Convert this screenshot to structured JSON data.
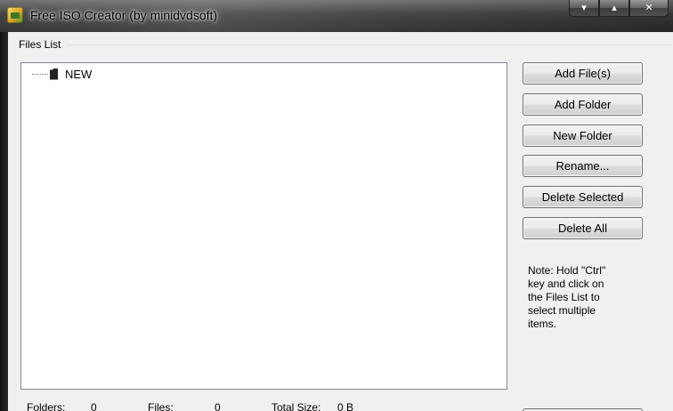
{
  "window": {
    "title": "Free ISO Creator (by minidvdsoft)",
    "caption_buttons": [
      "▾",
      "▴",
      "✕"
    ]
  },
  "files_list": {
    "label": "Files List",
    "tree_items": [
      {
        "label": "NEW"
      }
    ]
  },
  "buttons": {
    "add_files": "Add File(s)",
    "add_folder": "Add Folder",
    "new_folder": "New Folder",
    "rename": "Rename...",
    "delete_selected": "Delete Selected",
    "delete_all": "Delete All"
  },
  "note": "Note: Hold \"Ctrl\"\nkey and click on\nthe Files List to\nselect multiple\nitems.",
  "status": {
    "folders_label": "Folders:",
    "folders_value": "0",
    "files_label": "Files:",
    "files_value": "0",
    "total_size_label": "Total Size:",
    "total_size_value": "0 B"
  }
}
